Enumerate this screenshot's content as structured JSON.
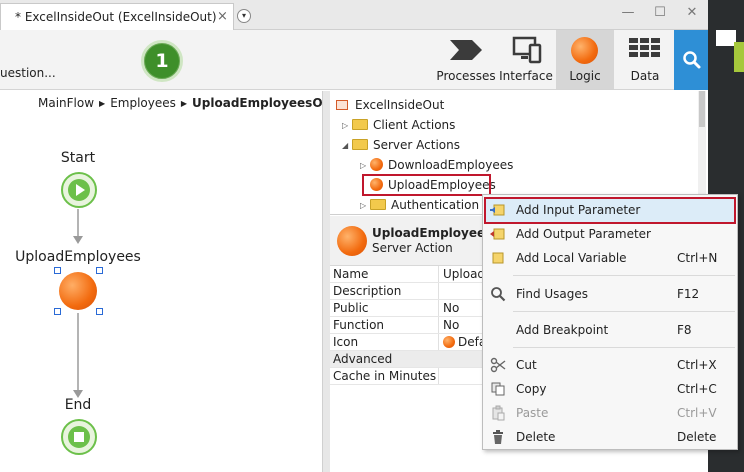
{
  "window": {
    "tab_title": "* ExcelInsideOut (ExcelInsideOut)",
    "close_glyph": "×",
    "dropdown_glyph": "▾",
    "minimize_glyph": "—",
    "restore_glyph": "☐",
    "close_window_glyph": "✕"
  },
  "toolbar": {
    "question_text": "uestion...",
    "step_number": "1",
    "processes_label": "Processes",
    "interface_label": "Interface",
    "logic_label": "Logic",
    "data_label": "Data",
    "search_icon": "search-icon"
  },
  "canvas": {
    "breadcrumb": [
      "MainFlow",
      "Employees",
      "UploadEmployeesOnClick"
    ],
    "breadcrumb_sep": "▶",
    "start_label": "Start",
    "action_label": "UploadEmployees",
    "end_label": "End"
  },
  "tree": {
    "root": "ExcelInsideOut",
    "items": [
      {
        "label": "Client Actions",
        "expander": "▷"
      },
      {
        "label": "Server Actions",
        "expander": "◢"
      },
      {
        "label": "DownloadEmployees",
        "expander": "▷"
      },
      {
        "label": "UploadEmployees",
        "expander": ""
      },
      {
        "label": "Authentication",
        "expander": "▷"
      }
    ]
  },
  "properties": {
    "title": "UploadEmployees",
    "subtitle": "Server Action",
    "rows": [
      {
        "name": "Name",
        "value": "Upload"
      },
      {
        "name": "Description",
        "value": ""
      },
      {
        "name": "Public",
        "value": "No"
      },
      {
        "name": "Function",
        "value": "No"
      },
      {
        "name": "Icon",
        "value": "Defa"
      }
    ],
    "section_advanced": "Advanced",
    "cache_label": "Cache in Minutes"
  },
  "context_menu": {
    "items": [
      {
        "label": "Add Input Parameter",
        "shortcut": ""
      },
      {
        "label": "Add Output Parameter",
        "shortcut": ""
      },
      {
        "label": "Add Local Variable",
        "shortcut": "Ctrl+N"
      },
      {
        "label": "Find Usages",
        "shortcut": "F12"
      },
      {
        "label": "Add Breakpoint",
        "shortcut": "F8"
      },
      {
        "label": "Cut",
        "shortcut": "Ctrl+X"
      },
      {
        "label": "Copy",
        "shortcut": "Ctrl+C"
      },
      {
        "label": "Paste",
        "shortcut": "Ctrl+V"
      },
      {
        "label": "Delete",
        "shortcut": "Delete"
      }
    ]
  },
  "colors": {
    "highlight_red": "#c0172d",
    "accent_blue": "#2e8fd6",
    "start_green": "#6cc04a",
    "action_orange": "#f26a0e"
  }
}
